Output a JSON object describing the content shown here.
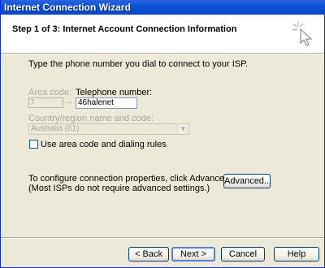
{
  "window": {
    "title": "Internet Connection Wizard"
  },
  "header": {
    "title": "Step 1 of 3: Internet Account Connection Information",
    "icon": "wizard-cursor-sparkle-icon"
  },
  "body": {
    "instruction": "Type the phone number you dial to connect to your ISP.",
    "area_code_label": "Area code:",
    "area_code_value": "7",
    "dash": "–",
    "telephone_label": "Telephone number:",
    "telephone_value": "46halenet",
    "country_label": "Country/region name and code:",
    "country_value": "Australia (61)",
    "use_rules_label": "Use area code and dialing rules",
    "use_rules_checked": false,
    "advanced_text_1": "To configure connection properties, click Advanced.",
    "advanced_text_2": "(Most ISPs do not require advanced settings.)",
    "advanced_button": "Advanced..."
  },
  "footer": {
    "back": "< Back",
    "next": "Next >",
    "cancel": "Cancel",
    "help": "Help"
  }
}
